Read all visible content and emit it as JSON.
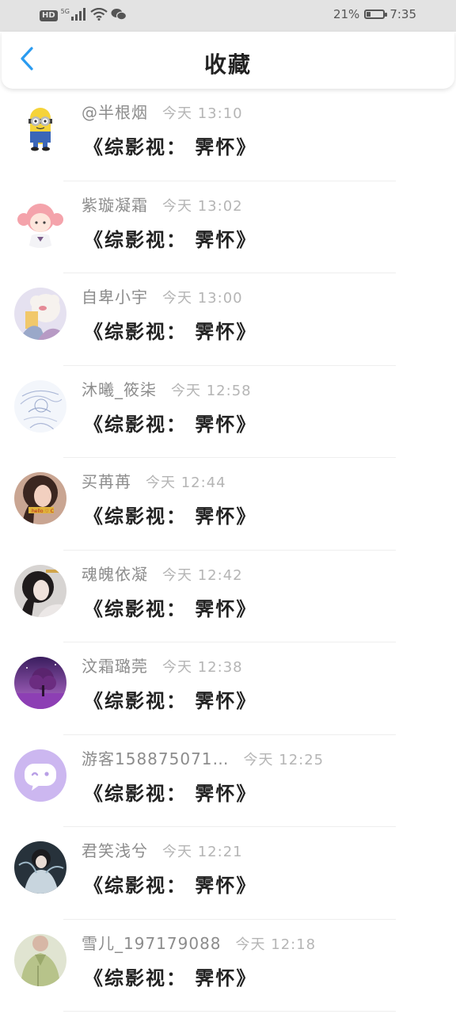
{
  "status_bar": {
    "hd": "HD",
    "network": "5G",
    "battery_percent": "21%",
    "battery_level": 0.21,
    "time": "7:35"
  },
  "header": {
    "title": "收藏"
  },
  "items": [
    {
      "name": "@半根烟",
      "time": "今天 13:10",
      "work": "《综影视： 霁怀》",
      "avatar": "minion-avatar"
    },
    {
      "name": "紫璇凝霜",
      "time": "今天 13:02",
      "work": "《综影视： 霁怀》",
      "avatar": "pink-hair-girl-avatar"
    },
    {
      "name": "自卑小宇",
      "time": "今天 13:00",
      "work": "《综影视： 霁怀》",
      "avatar": "anime-sheep-avatar"
    },
    {
      "name": "沐曦_筱柒",
      "time": "今天 12:58",
      "work": "《综影视： 霁怀》",
      "avatar": "sketch-anime-avatar"
    },
    {
      "name": "买苒苒",
      "time": "今天 12:44",
      "work": "《综影视： 霁怀》",
      "avatar": "photo-girl-avatar"
    },
    {
      "name": "魂魄依凝",
      "time": "今天 12:42",
      "work": "《综影视： 霁怀》",
      "avatar": "dark-hair-girl-avatar"
    },
    {
      "name": "汶霜璐莞",
      "time": "今天 12:38",
      "work": "《综影视： 霁怀》",
      "avatar": "purple-tree-avatar"
    },
    {
      "name": "游客158875071…",
      "time": "今天 12:25",
      "work": "《综影视： 霁怀》",
      "avatar": "guest-chat-avatar"
    },
    {
      "name": "君笑浅兮",
      "time": "今天 12:21",
      "work": "《综影视： 霁怀》",
      "avatar": "ancient-costume-avatar"
    },
    {
      "name": "雪儿_197179088",
      "time": "今天 12:18",
      "work": "《综影视： 霁怀》",
      "avatar": "green-outfit-avatar"
    }
  ]
}
